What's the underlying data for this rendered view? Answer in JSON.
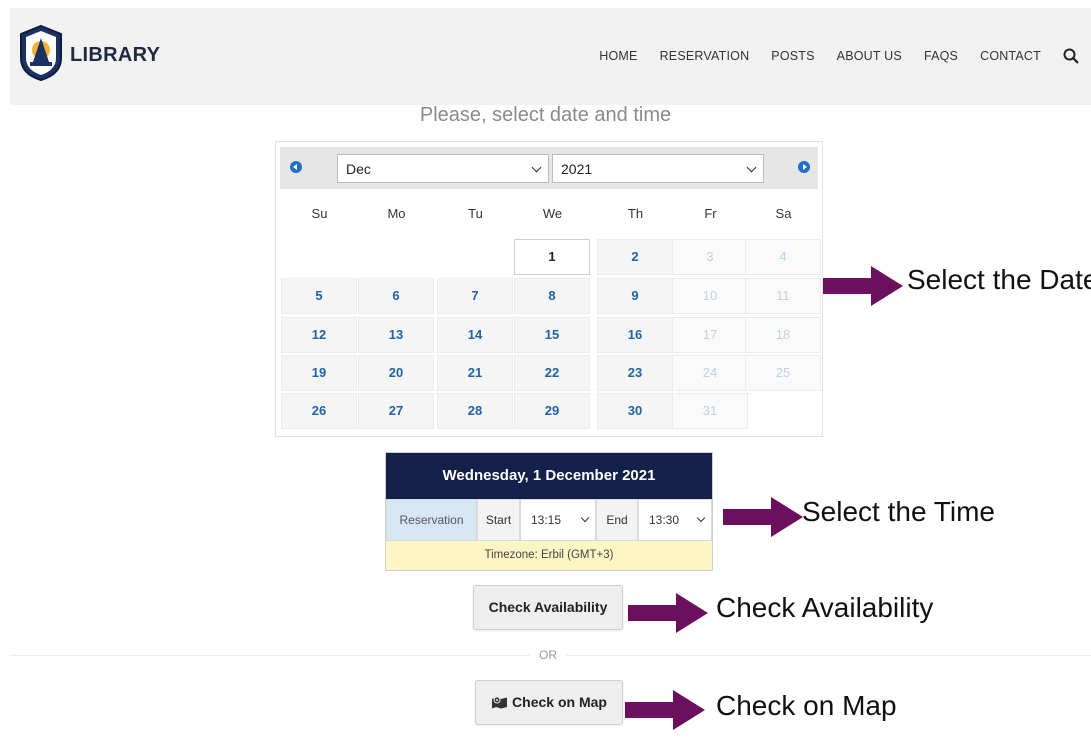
{
  "header": {
    "brand": "LIBRARY",
    "nav": [
      "HOME",
      "RESERVATION",
      "POSTS",
      "ABOUT US",
      "FAQS",
      "CONTACT"
    ]
  },
  "prompt": "Please, select date and time",
  "calendar": {
    "month": "Dec",
    "year": "2021",
    "weekdays": [
      "Su",
      "Mo",
      "Tu",
      "We",
      "Th",
      "Fr",
      "Sa"
    ],
    "weeks": [
      [
        "",
        "",
        "",
        "1",
        "2",
        "3",
        "4"
      ],
      [
        "5",
        "6",
        "7",
        "8",
        "9",
        "10",
        "11"
      ],
      [
        "12",
        "13",
        "14",
        "15",
        "16",
        "17",
        "18"
      ],
      [
        "19",
        "20",
        "21",
        "22",
        "23",
        "24",
        "25"
      ],
      [
        "26",
        "27",
        "28",
        "29",
        "30",
        "31",
        ""
      ]
    ],
    "selected_day": "1"
  },
  "time_picker": {
    "title": "Wednesday, 1 December 2021",
    "reservation_label": "Reservation",
    "start_label": "Start",
    "start_value": "13:15",
    "end_label": "End",
    "end_value": "13:30",
    "timezone": "Timezone: Erbil (GMT+3)"
  },
  "buttons": {
    "check_availability": "Check Availability",
    "or": "OR",
    "check_on_map": "Check on Map"
  },
  "annotations": {
    "select_date": "Select the Date",
    "select_time": "Select the Time",
    "check_availability": "Check Availability",
    "check_on_map": "Check on Map",
    "arrow_color": "#6b0f5e"
  },
  "colors": {
    "header_bg": "#f1f1f1",
    "accent_blue": "#1f63a8",
    "title_navy": "#13204a",
    "timezone_bg": "#fbf6c4"
  }
}
